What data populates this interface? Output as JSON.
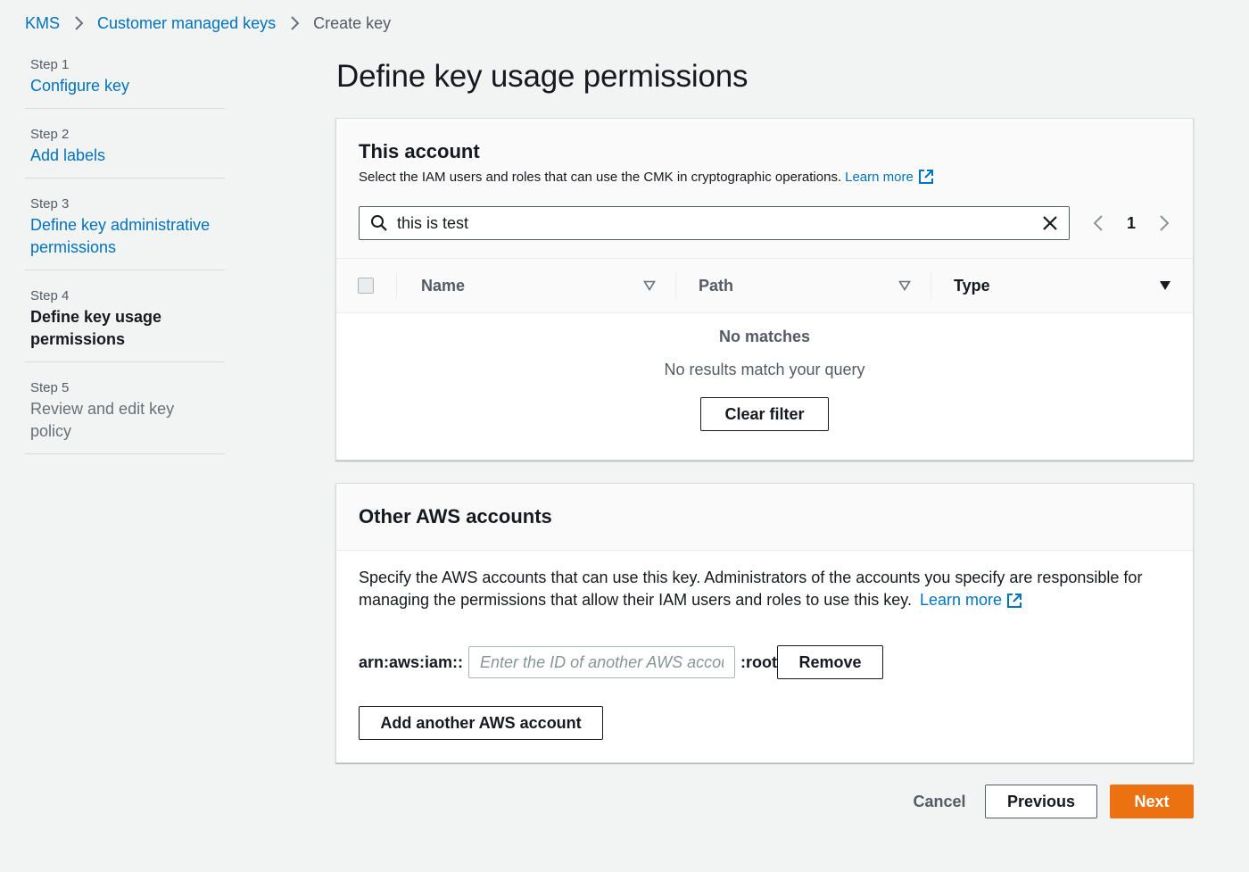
{
  "breadcrumb": {
    "items": [
      "KMS",
      "Customer managed keys"
    ],
    "current": "Create key"
  },
  "steps": [
    {
      "num": "Step 1",
      "title": "Configure key",
      "state": "link"
    },
    {
      "num": "Step 2",
      "title": "Add labels",
      "state": "link"
    },
    {
      "num": "Step 3",
      "title": "Define key administrative permissions",
      "state": "link"
    },
    {
      "num": "Step 4",
      "title": "Define key usage permissions",
      "state": "current"
    },
    {
      "num": "Step 5",
      "title": "Review and edit key policy",
      "state": "disabled"
    }
  ],
  "page_title": "Define key usage permissions",
  "this_account": {
    "title": "This account",
    "description": "Select the IAM users and roles that can use the CMK in cryptographic operations.",
    "learn_more": "Learn more",
    "search_value": "this is test",
    "page": "1",
    "columns": {
      "name": "Name",
      "path": "Path",
      "type": "Type"
    },
    "empty_title": "No matches",
    "empty_text": "No results match your query",
    "clear_filter": "Clear filter"
  },
  "other_accounts": {
    "title": "Other AWS accounts",
    "description": "Specify the AWS accounts that can use this key. Administrators of the accounts you specify are responsible for managing the permissions that allow their IAM users and roles to use this key.",
    "learn_more": "Learn more",
    "arn_prefix": "arn:aws:iam::",
    "account_placeholder": "Enter the ID of another AWS account",
    "arn_suffix": ":root",
    "remove": "Remove",
    "add_account": "Add another AWS account"
  },
  "footer": {
    "cancel": "Cancel",
    "previous": "Previous",
    "next": "Next"
  },
  "colors": {
    "link": "#0073bb",
    "primary": "#ec7211",
    "background": "#f2f3f3"
  }
}
